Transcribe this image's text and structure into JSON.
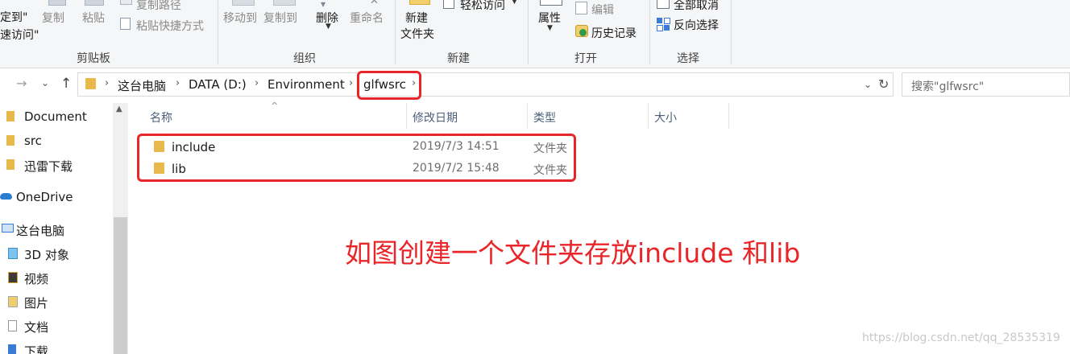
{
  "ribbon": {
    "clipboard": {
      "pin_line1": "定到\"",
      "pin_line2": "速访问\"",
      "copy": "复制",
      "paste": "粘贴",
      "copy_path": "复制路径",
      "paste_shortcut": "粘贴快捷方式",
      "group_label": "剪贴板"
    },
    "organize": {
      "move_to": "移动到",
      "copy_to": "复制到",
      "delete": "删除",
      "rename": "重命名",
      "group_label": "组织"
    },
    "new": {
      "easy_access": "轻松访问",
      "new_folder_line1": "新建",
      "new_folder_line2": "文件夹",
      "group_label": "新建"
    },
    "open": {
      "properties": "属性",
      "edit": "编辑",
      "history": "历史记录",
      "group_label": "打开"
    },
    "select": {
      "select_none": "全部取消",
      "invert_selection": "反向选择",
      "group_label": "选择"
    }
  },
  "address": {
    "crumbs": [
      "这台电脑",
      "DATA (D:)",
      "Environment",
      "glfwsrc"
    ],
    "search_placeholder": "搜索\"glfwsrc\""
  },
  "nav": {
    "items": [
      "Document",
      "src",
      "迅雷下载",
      "OneDrive",
      "这台电脑",
      "3D 对象",
      "视频",
      "图片",
      "文档",
      "下载"
    ]
  },
  "columns": {
    "name": "名称",
    "modified": "修改日期",
    "type": "类型",
    "size": "大小"
  },
  "files": [
    {
      "name": "include",
      "modified": "2019/7/3 14:51",
      "type": "文件夹"
    },
    {
      "name": "lib",
      "modified": "2019/7/2 15:48",
      "type": "文件夹"
    }
  ],
  "annotation": "如图创建一个文件夹存放include 和lib",
  "watermark": "https://blog.csdn.net/qq_28535319",
  "colors": {
    "annotation_red": "#e8262a",
    "folder_yellow": "#e8b84b"
  }
}
